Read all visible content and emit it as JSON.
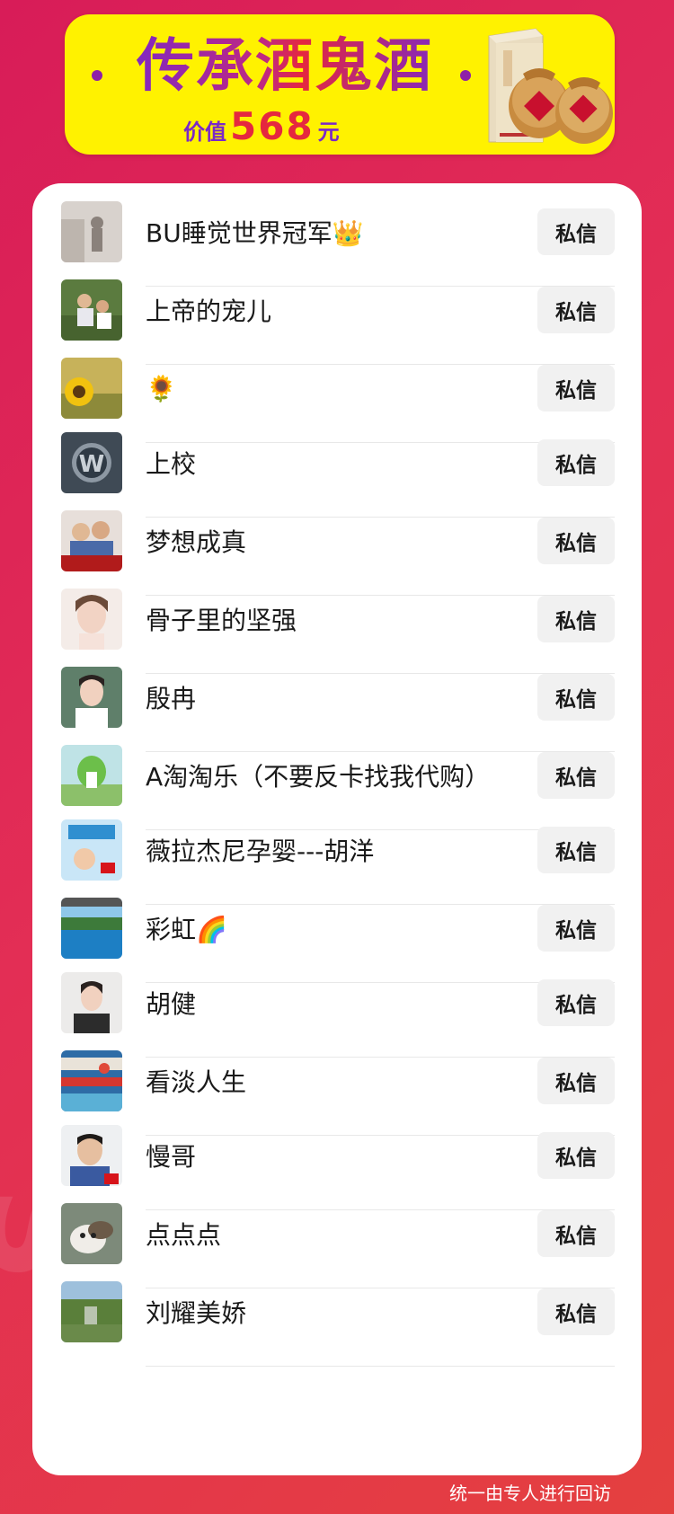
{
  "banner": {
    "title": "传承酒鬼酒",
    "price_label": "价值",
    "price_value": "568",
    "price_unit": "元"
  },
  "list": {
    "button_label": "私信",
    "items": [
      {
        "name": "BU睡觉世界冠军👑",
        "avatar": "silhouette-avatar"
      },
      {
        "name": "上帝的宠儿",
        "avatar": "outdoor-children-avatar"
      },
      {
        "name": "🌻",
        "avatar": "sunflower-avatar"
      },
      {
        "name": "上校",
        "avatar": "car-logo-avatar"
      },
      {
        "name": "梦想成真",
        "avatar": "family-avatar"
      },
      {
        "name": "骨子里的坚强",
        "avatar": "woman-portrait-avatar"
      },
      {
        "name": "殷冉",
        "avatar": "woman-portrait-avatar"
      },
      {
        "name": "A淘淘乐（不要反卡找我代购）",
        "avatar": "cartoon-avatar"
      },
      {
        "name": "薇拉杰尼孕婴---胡洋",
        "avatar": "baby-poster-avatar"
      },
      {
        "name": "彩虹🌈",
        "avatar": "lake-landscape-avatar"
      },
      {
        "name": "胡健",
        "avatar": "woman-portrait-avatar"
      },
      {
        "name": "看淡人生",
        "avatar": "painting-avatar"
      },
      {
        "name": "慢哥",
        "avatar": "man-portrait-avatar"
      },
      {
        "name": "点点点",
        "avatar": "dog-avatar"
      },
      {
        "name": "刘耀美娇",
        "avatar": "forest-landscape-avatar"
      }
    ]
  },
  "footer": {
    "note": "统一由专人进行回访"
  },
  "colors": {
    "background_start": "#d81c58",
    "background_end": "#e4403f",
    "banner_yellow": "#fff200",
    "title_purple": "#7a28c8",
    "price_red": "#e5283f",
    "button_bg": "#f1f1f1"
  }
}
